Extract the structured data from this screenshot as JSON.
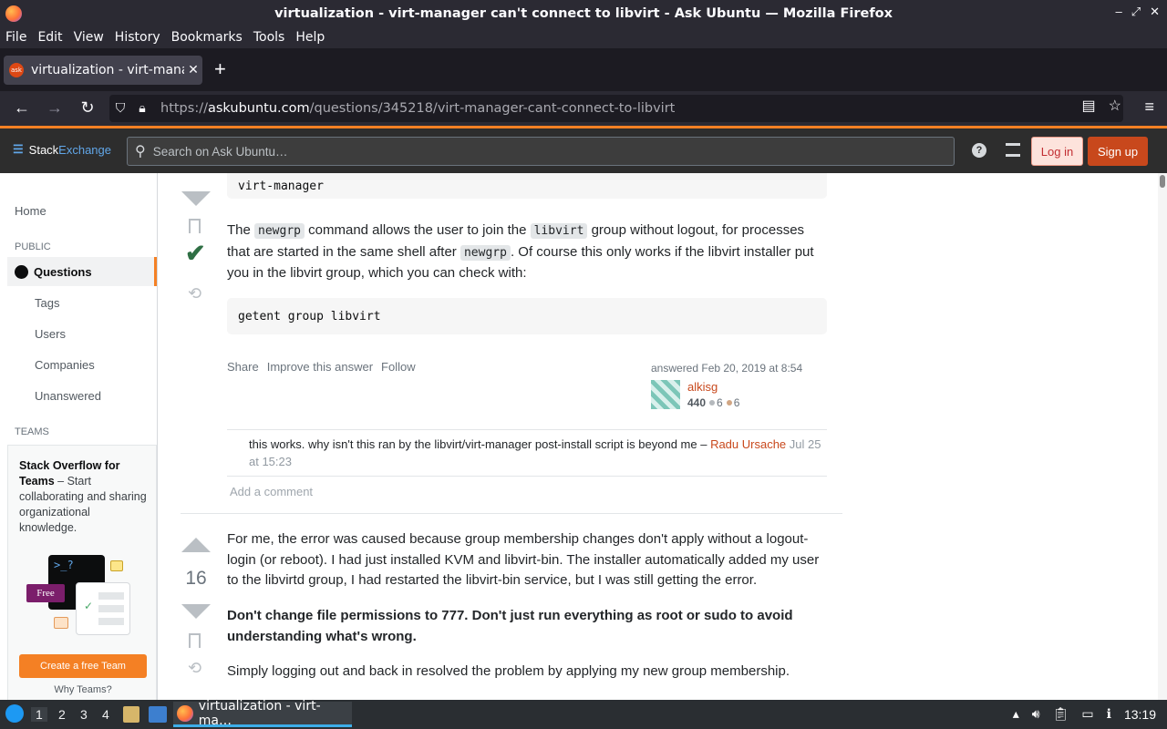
{
  "window": {
    "title": "virtualization - virt-manager can't connect to libvirt - Ask Ubuntu — Mozilla Firefox",
    "controls": [
      "–",
      "⤢",
      "✕"
    ]
  },
  "menubar": [
    "File",
    "Edit",
    "View",
    "History",
    "Bookmarks",
    "Tools",
    "Help"
  ],
  "tab": {
    "label": "virtualization - virt-manager can't connect to libvirt",
    "close": "✕",
    "new": "+"
  },
  "url": {
    "prefix": "https://",
    "domain": "askubuntu.com",
    "path": "/questions/345218/virt-manager-cant-connect-to-libvirt"
  },
  "header": {
    "logo_stack": "Stack",
    "logo_exchange": "Exchange",
    "search_placeholder": "Search on Ask Ubuntu…",
    "help": "?",
    "login": "Log in",
    "signup": "Sign up"
  },
  "leftnav": {
    "home": "Home",
    "public_heading": "PUBLIC",
    "questions": "Questions",
    "tags": "Tags",
    "users": "Users",
    "companies": "Companies",
    "unanswered": "Unanswered",
    "teams_heading": "TEAMS",
    "teams_title": "Stack Overflow for Teams",
    "teams_text": " – Start collaborating and sharing organizational knowledge.",
    "teams_free": "Free",
    "teams_term": ">_?",
    "teams_cta": "Create a free Team",
    "teams_why": "Why Teams?"
  },
  "answer1": {
    "code_top": "virt-manager",
    "p1_a": "The ",
    "p1_code1": "newgrp",
    "p1_b": " command allows the user to join the ",
    "p1_code2": "libvirt",
    "p1_c": " group without logout, for processes that are started in the same shell after ",
    "p1_code3": "newgrp",
    "p1_d": ". Of course this only works if the libvirt installer put you in the libvirt group, which you can check with:",
    "code2": "getent group libvirt",
    "actions": [
      "Share",
      "Improve this answer",
      "Follow"
    ],
    "answered": "answered Feb 20, 2019 at 8:54",
    "user": "alkisg",
    "rep": "440",
    "silver": "6",
    "bronze": "6",
    "comment_text": "this works. why isn't this ran by the libvirt/virt-manager post-install script is beyond me – ",
    "comment_author": "Radu Ursache",
    "comment_date": "Jul 25 at 15:23",
    "add_comment": "Add a comment"
  },
  "answer2": {
    "score": "16",
    "p1": "For me, the error was caused because group membership changes don't apply without a logout-login (or reboot). I had just installed KVM and libvirt-bin. The installer automatically added my user to the libvirtd group, I had restarted the libvirt-bin service, but I was still getting the error.",
    "p2": "Don't change file permissions to 777. Don't just run everything as root or sudo to avoid understanding what's wrong.",
    "p3": "Simply logging out and back in resolved the problem by applying my new group membership."
  },
  "taskbar": {
    "workspaces": [
      "1",
      "2",
      "3",
      "4"
    ],
    "task": "virtualization - virt-ma…",
    "clock": "13:19"
  },
  "colors": {
    "accent": "#f48024",
    "brand_red": "#c8481c",
    "accepted": "#2f6f44"
  }
}
